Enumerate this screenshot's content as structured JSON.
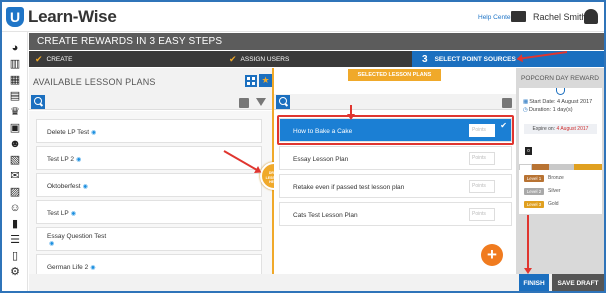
{
  "app": {
    "logo_letter": "U",
    "name": "Learn-Wise"
  },
  "topbar": {
    "help_label": "Help Center",
    "user_name": "Rachel Smith"
  },
  "page": {
    "title": "CREATE REWARDS IN 3 EASY STEPS"
  },
  "steps": [
    {
      "number": "",
      "label": "CREATE",
      "state": "done"
    },
    {
      "number": "",
      "label": "ASSIGN USERS",
      "state": "done"
    },
    {
      "number": "3",
      "label": "SELECT POINT SOURCES",
      "state": "active"
    }
  ],
  "left_panel": {
    "title": "AVAILABLE LESSON PLANS",
    "items": [
      {
        "label": "Delete LP Test"
      },
      {
        "label": "Test LP 2"
      },
      {
        "label": "Oktoberfest"
      },
      {
        "label": "Test LP"
      },
      {
        "label": "Essay Question Test"
      },
      {
        "label": "German Life 2"
      }
    ]
  },
  "drag_hint": {
    "line1": "DRAG",
    "line2": "LESSONS",
    "line3": "HERE"
  },
  "middle_panel": {
    "title": "SELECTED LESSON PLANS",
    "points_placeholder": "Points",
    "items": [
      {
        "label": "How to Bake a Cake",
        "selected": true
      },
      {
        "label": "Essay Lesson Plan",
        "selected": false
      },
      {
        "label": "Retake even if passed test lesson plan",
        "selected": false
      },
      {
        "label": "Cats Test Lesson Plan",
        "selected": false
      }
    ],
    "add_label": "+"
  },
  "reward": {
    "title": "POPCORN DAY REWARD",
    "start_date": "Start Date: 4 August 2017",
    "duration": "Duration: 1 day(s)",
    "expire_label": "Expire on:",
    "expire_date": "4 August 2017",
    "current_points": "0",
    "scale_ticks": [
      "10",
      "25",
      "45"
    ],
    "levels": [
      {
        "name": "Level 1",
        "medal": "Bronze",
        "color": "#b87333"
      },
      {
        "name": "Level 2",
        "medal": "Silver",
        "color": "#a9a9a9"
      },
      {
        "name": "Level 3",
        "medal": "Gold",
        "color": "#e0a020"
      }
    ]
  },
  "footer": {
    "finish_label": "FINISH",
    "save_draft_label": "SAVE DRAFT"
  },
  "colors": {
    "primary": "#1b6fbf",
    "accent": "#f0a92a",
    "header": "#5c5c5c",
    "highlight": "#e0352f"
  }
}
